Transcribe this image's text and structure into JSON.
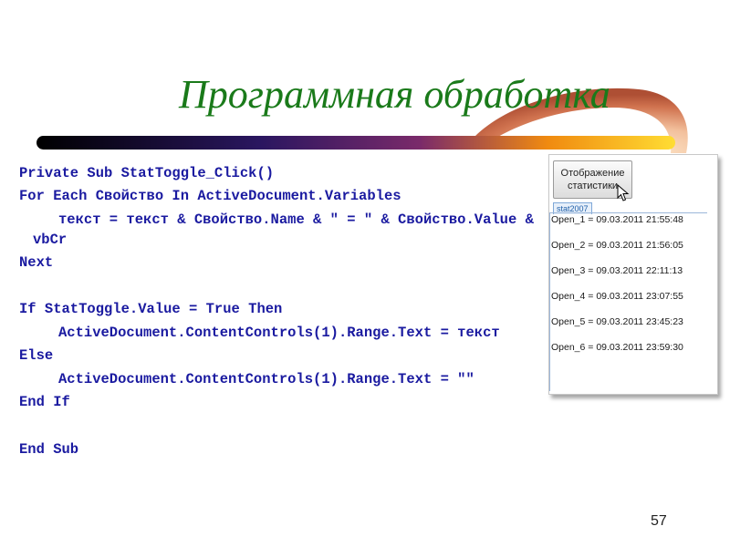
{
  "slide": {
    "title": "Программная обработка",
    "page_number": "57"
  },
  "code": {
    "lines": [
      "Private Sub StatToggle_Click()",
      "For Each Свойство In ActiveDocument.Variables",
      "текст = текст & Свойство.Name & \" = \" & Свойство.Value &",
      "vbCr",
      "Next",
      "If StatToggle.Value = True Then",
      "ActiveDocument.ContentControls(1).Range.Text = текст",
      "Else",
      "ActiveDocument.ContentControls(1).Range.Text = \"\"",
      "End If",
      "End Sub"
    ]
  },
  "screenshot": {
    "button_label_1": "Отображение",
    "button_label_2": "статистики",
    "content_control_tag": "stat2007",
    "stats": [
      "Open_1 = 09.03.2011 21:55:48",
      "Open_2 = 09.03.2011 21:56:05",
      "Open_3 = 09.03.2011 22:11:13",
      "Open_4 = 09.03.2011 23:07:55",
      "Open_5 = 09.03.2011 23:45:23",
      "Open_6 = 09.03.2011 23:59:30"
    ]
  },
  "colors": {
    "title": "#1a7a1a",
    "code": "#1a1aa0",
    "swoosh_start": "#000000",
    "swoosh_mid": "#3a1a6a",
    "swoosh_end": "#ffcc00"
  }
}
